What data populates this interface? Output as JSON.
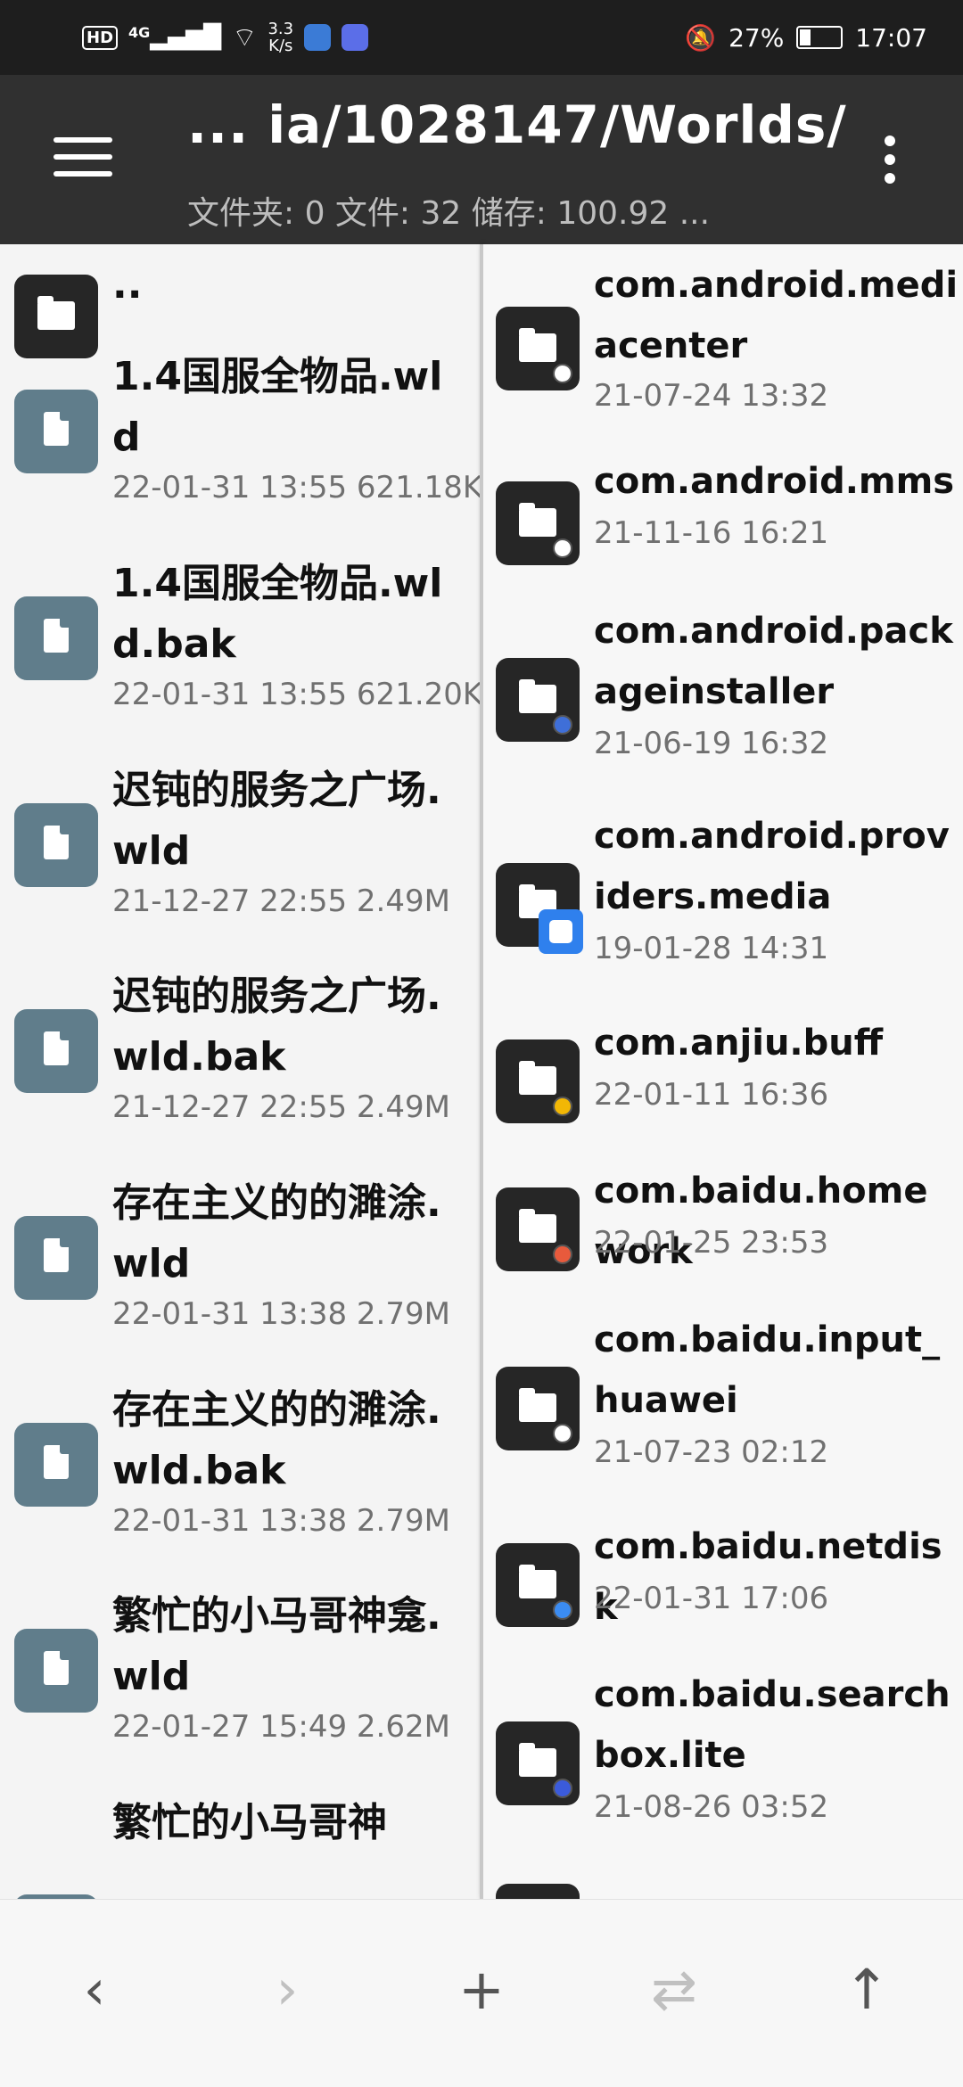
{
  "status_bar": {
    "hd": "HD",
    "network": "4G",
    "speed_value": "3.3",
    "speed_unit": "K/s",
    "battery": "27%",
    "time": "17:07"
  },
  "toolbar": {
    "title": "... ia/1028147/Worlds/",
    "subtitle": "文件夹: 0  文件: 32  储存: 100.92 ..."
  },
  "left_pane": {
    "items": [
      {
        "name": "..",
        "meta": "",
        "type": "folder"
      },
      {
        "name": "1.4国服全物品.wld",
        "meta": "22-01-31 13:55  621.18K",
        "type": "file"
      },
      {
        "name": "1.4国服全物品.wld.bak",
        "meta": "22-01-31 13:55  621.20K",
        "type": "file"
      },
      {
        "name": "迟钝的服务之广场.wld",
        "meta": "21-12-27 22:55  2.49M",
        "type": "file"
      },
      {
        "name": "迟钝的服务之广场.wld.bak",
        "meta": "21-12-27 22:55  2.49M",
        "type": "file"
      },
      {
        "name": "存在主义的的濉涂.wld",
        "meta": "22-01-31 13:38  2.79M",
        "type": "file"
      },
      {
        "name": "存在主义的的濉涂.wld.bak",
        "meta": "22-01-31 13:38  2.79M",
        "type": "file"
      },
      {
        "name": "繁忙的小马哥神龛.wld",
        "meta": "22-01-27 15:49  2.62M",
        "type": "file"
      },
      {
        "name": "繁忙的小马哥神",
        "meta": "",
        "type": "file"
      }
    ]
  },
  "right_pane": {
    "items": [
      {
        "name": "com.android.mediacenter",
        "meta": "21-07-24 13:32"
      },
      {
        "name": "com.android.mms",
        "meta": "21-11-16 16:21"
      },
      {
        "name": "com.android.packageinstaller",
        "meta": "21-06-19 16:32"
      },
      {
        "name": "com.android.providers.media",
        "meta": "19-01-28 14:31"
      },
      {
        "name": "com.anjiu.buff",
        "meta": "22-01-11 16:36"
      },
      {
        "name": "com.baidu.homework",
        "meta": "22-01-25 23:53"
      },
      {
        "name": "com.baidu.input_huawei",
        "meta": "21-07-23 02:12"
      },
      {
        "name": "com.baidu.netdisk",
        "meta": "22-01-31 17:06"
      },
      {
        "name": "com.baidu.searchbox.lite",
        "meta": "21-08-26 03:52"
      }
    ]
  },
  "bottom_bar": {
    "back": "‹",
    "forward": "›",
    "add": "+",
    "swap": "⇄",
    "up": "↑"
  },
  "colors": {
    "toolbar": "#303030",
    "statusbar": "#1e1e1e",
    "file_icon": "#607d8b",
    "folder_icon": "#262626",
    "puzzle_badge": "#2f80ed"
  }
}
